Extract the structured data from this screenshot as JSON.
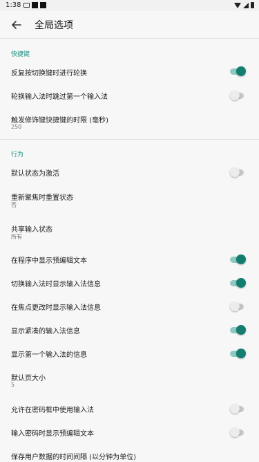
{
  "status_bar": {
    "time": "1:38"
  },
  "toolbar": {
    "title": "全局选项"
  },
  "sections": {
    "shortcuts": "快捷键",
    "behavior": "行为"
  },
  "prefs": {
    "cycle_repeat": {
      "title": "反复按切换键时进行轮换",
      "checked": true
    },
    "skip_first": {
      "title": "轮换输入法时跳过第一个输入法",
      "checked": false
    },
    "modifier_timeout": {
      "title": "触发修饰键快捷键的时限 (毫秒)",
      "summary": "250"
    },
    "default_active": {
      "title": "默认状态为激活",
      "checked": false
    },
    "reset_on_focus": {
      "title": "重新聚焦时重置状态",
      "summary": "否"
    },
    "share_state": {
      "title": "共享输入状态",
      "summary": "所有"
    },
    "show_preedit_in_app": {
      "title": "在程序中显示预编辑文本",
      "checked": true
    },
    "show_im_info_on_switch": {
      "title": "切换输入法时显示输入法信息",
      "checked": true
    },
    "show_im_info_on_focus": {
      "title": "在焦点更改时显示输入法信息",
      "checked": false
    },
    "compact_im_info": {
      "title": "显示紧凑的输入法信息",
      "checked": true
    },
    "show_first_im_info": {
      "title": "显示第一个输入法的信息",
      "checked": true
    },
    "default_page_size": {
      "title": "默认页大小",
      "summary": "5"
    },
    "allow_in_password": {
      "title": "允许在密码框中使用输入法",
      "checked": false
    },
    "show_preedit_in_password": {
      "title": "输入密码时显示预编辑文本",
      "checked": false
    },
    "save_interval": {
      "title": "保存用户数据的时间间隔 (以分钟为单位)"
    }
  },
  "colors": {
    "accent": "#1f8f80",
    "switch_on": "#137d70"
  }
}
